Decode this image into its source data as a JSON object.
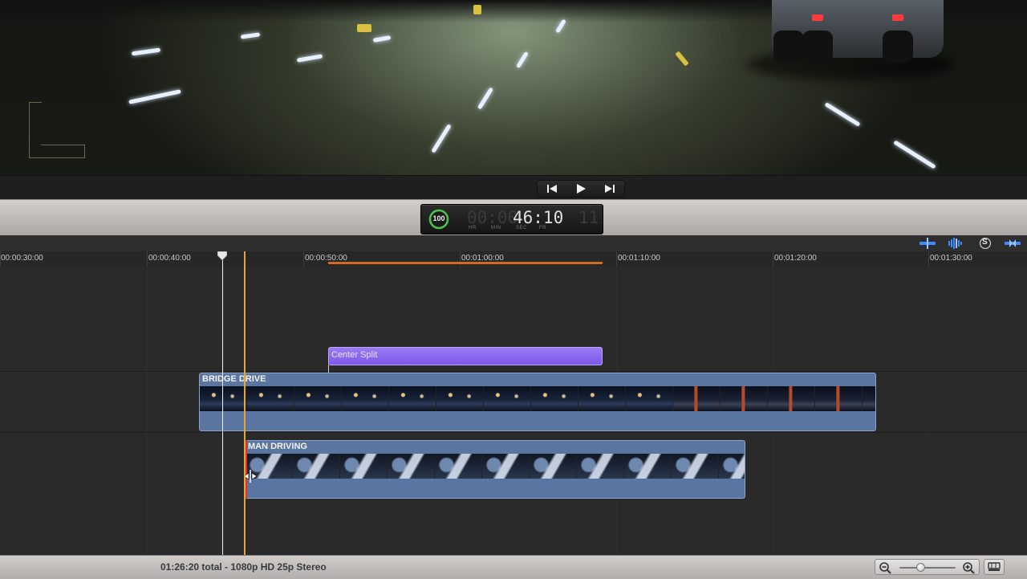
{
  "viewer": {
    "description_icons": [
      "lower-third-guide-icon"
    ]
  },
  "transport": {
    "buttons": [
      {
        "name": "go-to-start",
        "icon": "skip-back-icon"
      },
      {
        "name": "play",
        "icon": "play-icon"
      },
      {
        "name": "go-to-end",
        "icon": "skip-forward-icon"
      }
    ]
  },
  "dashboard": {
    "progress": "100",
    "timecode_dim": "00:00",
    "timecode_main": "46:10",
    "timecode_tail": "11",
    "units": {
      "hr": "HR",
      "min": "MIN",
      "sec": "SEC",
      "fr": "FR"
    }
  },
  "toolbar": {
    "icons": [
      "video-skimming-icon",
      "audio-skimming-icon",
      "solo-icon",
      "snapping-icon"
    ],
    "solo_label": "S"
  },
  "ruler": {
    "ticks": [
      "00:00:30:00",
      "00:00:40:00",
      "00:00:50:00",
      "00:01:00:00",
      "00:01:10:00",
      "00:01:20:00",
      "00:01:30:00"
    ]
  },
  "clips": {
    "title_clip": "Center Split",
    "primary_clip": "BRIDGE DRIVE",
    "connected_clip": "MAN DRIVING"
  },
  "bottom": {
    "info": "01:26:20 total - 1080p HD 25p Stereo",
    "zoom_level": 0.35
  },
  "colors": {
    "title_clip": "#8a66ee",
    "video_clip": "#5a76a0",
    "skimmer": "#e8a530",
    "range": "#d66a1c",
    "trim_edge": "#e03030",
    "tool_icons": "#3d8bff"
  }
}
